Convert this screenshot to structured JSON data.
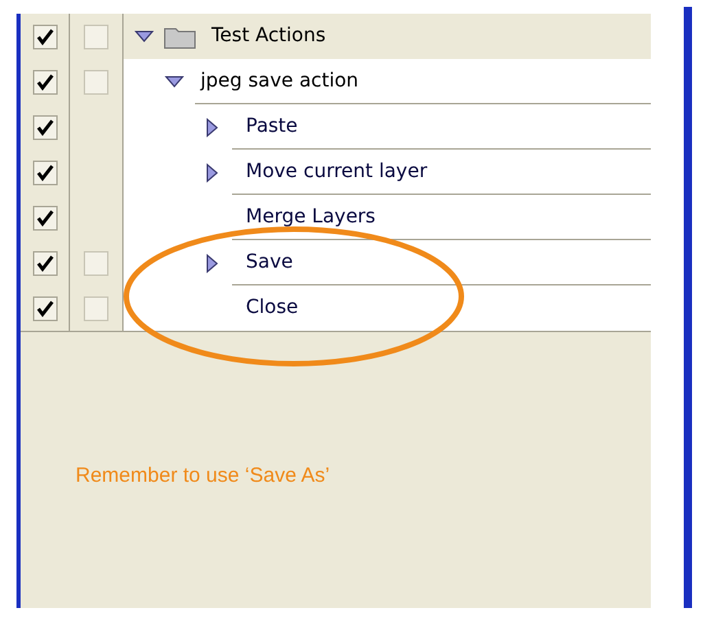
{
  "actions_panel": {
    "set": {
      "name": "Test Actions",
      "enabled": true,
      "dialog_toggle": true,
      "expanded": true,
      "children": [
        {
          "name": "jpeg save action",
          "enabled": true,
          "dialog_toggle": true,
          "expanded": true,
          "children": [
            {
              "name": "Paste",
              "enabled": true,
              "dialog_toggle": false,
              "expandable": true
            },
            {
              "name": "Move current layer",
              "enabled": true,
              "dialog_toggle": false,
              "expandable": true
            },
            {
              "name": "Merge Layers",
              "enabled": true,
              "dialog_toggle": false,
              "expandable": false
            },
            {
              "name": "Save",
              "enabled": true,
              "dialog_toggle": true,
              "expandable": true
            },
            {
              "name": "Close",
              "enabled": true,
              "dialog_toggle": true,
              "expandable": false
            }
          ]
        }
      ]
    }
  },
  "annotation": {
    "note": "Remember to use ‘Save As’"
  }
}
